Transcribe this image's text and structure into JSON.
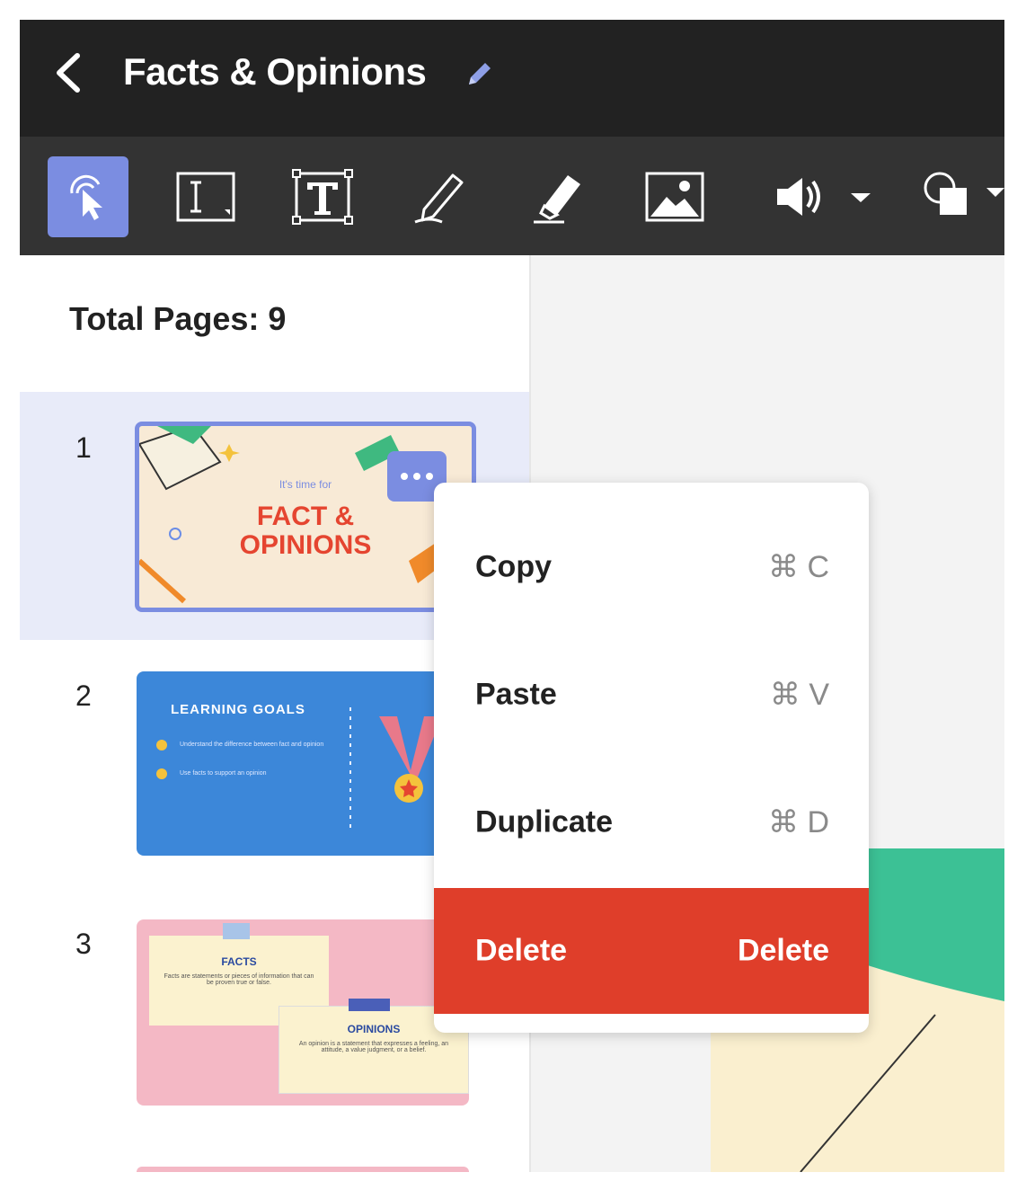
{
  "header": {
    "title": "Facts & Opinions"
  },
  "toolbar": {
    "tools": [
      "select-tool",
      "text-box-tool",
      "text-tool",
      "pen-tool",
      "highlighter-tool",
      "image-tool",
      "audio-tool",
      "shapes-tool"
    ]
  },
  "sidebar": {
    "total_pages": "Total Pages: 9",
    "pages": [
      {
        "number": "1",
        "thumb": {
          "pre": "It's time for",
          "line1": "FACT &",
          "line2": "OPINIONS"
        }
      },
      {
        "number": "2",
        "thumb": {
          "heading": "LEARNING GOALS",
          "bullet1": "Understand the difference between fact and opinion",
          "bullet2": "Use facts to support an opinion"
        }
      },
      {
        "number": "3",
        "thumb": {
          "card1_title": "FACTS",
          "card1_text": "Facts are statements or pieces of information that can be proven true or false.",
          "card2_title": "OPINIONS",
          "card2_text": "An opinion is a statement that expresses a feeling, an attitude, a value judgment, or a belief."
        }
      }
    ]
  },
  "context_menu": {
    "items": [
      {
        "label": "Copy",
        "shortcut": "⌘ C"
      },
      {
        "label": "Paste",
        "shortcut": "⌘ V"
      },
      {
        "label": "Duplicate",
        "shortcut": "⌘ D"
      },
      {
        "label": "Delete",
        "shortcut": "Delete"
      }
    ]
  },
  "colors": {
    "accent": "#7b8de1",
    "danger": "#df3e2a",
    "titlebar": "#222222",
    "toolbar": "#333333"
  }
}
